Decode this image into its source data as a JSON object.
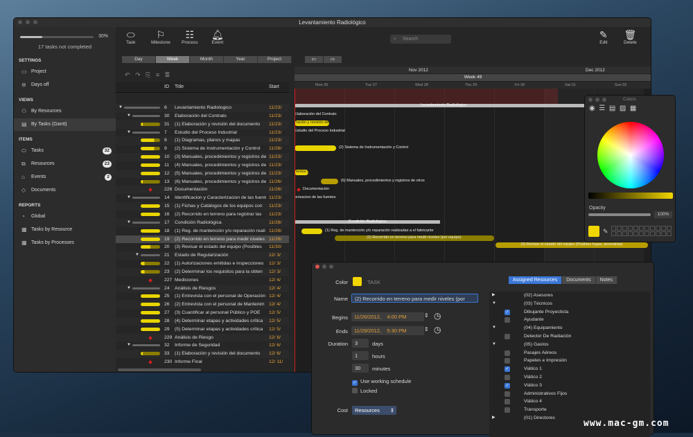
{
  "window": {
    "title": "Levantamiento Radiológico"
  },
  "sidebar": {
    "progress_pct": "30%",
    "progress": 0.3,
    "tasks_not_completed": "17 tasks not completed",
    "sections": [
      {
        "label": "SETTINGS",
        "items": [
          {
            "label": "Project",
            "icon": "project-icon"
          },
          {
            "label": "Days off",
            "icon": "days-off-icon"
          }
        ]
      },
      {
        "label": "VIEWS",
        "items": [
          {
            "label": "By Resources",
            "icon": "resources-icon"
          },
          {
            "label": "By Tasks (Gantt)",
            "icon": "gantt-icon",
            "selected": true
          }
        ]
      },
      {
        "label": "ITEMS",
        "items": [
          {
            "label": "Tasks",
            "count": "32"
          },
          {
            "label": "Resources",
            "count": "23"
          },
          {
            "label": "Events",
            "count": "2"
          },
          {
            "label": "Documents"
          }
        ]
      },
      {
        "label": "REPORTS",
        "items": [
          {
            "label": "Global"
          },
          {
            "label": "Tasks by Resource"
          },
          {
            "label": "Tasks by Processes"
          }
        ]
      }
    ]
  },
  "toolbar": {
    "task": "Task",
    "milestone": "Milestone",
    "process": "Process",
    "event": "Event",
    "search": "Search",
    "edit": "Edit",
    "delete": "Delete"
  },
  "scale": {
    "options": [
      "Day",
      "Week",
      "Month",
      "Year",
      "Project"
    ],
    "selected": "Week"
  },
  "table": {
    "headers": {
      "id": "ID",
      "title": "Title",
      "start": "Start"
    },
    "rows": [
      {
        "id": "6",
        "title": "Levantamiento Radiologico",
        "start": "11/23/",
        "type": "group",
        "indent": 0
      },
      {
        "id": "30",
        "title": "Elaboración del Contrato",
        "start": "11/23/",
        "type": "group",
        "indent": 1
      },
      {
        "id": "31",
        "title": "(1) Elaboración y revisión del documento",
        "start": "11/23/",
        "type": "task",
        "progress": 0.1
      },
      {
        "id": "7",
        "title": "Estudio del Proceso Industrial",
        "start": "11/23/",
        "type": "group",
        "indent": 1
      },
      {
        "id": "8",
        "title": "(1) Diagramas, planos y mapas",
        "start": "11/23/",
        "type": "task",
        "progress": 0.7
      },
      {
        "id": "9",
        "title": "(2) Sistema de Instrumentación y Control",
        "start": "11/26/",
        "type": "task",
        "progress": 0.7
      },
      {
        "id": "10",
        "title": "(3) Manuales, procedimientos y registros de",
        "start": "11/23/",
        "type": "task",
        "progress": 1
      },
      {
        "id": "11",
        "title": "(4) Manuales, procedimientos y registros de",
        "start": "11/23/",
        "type": "task",
        "progress": 1
      },
      {
        "id": "12",
        "title": "(5) Manuales, procedimientos y registros de",
        "start": "11/23/",
        "type": "task",
        "progress": 1
      },
      {
        "id": "13",
        "title": "(6) Manuales, procedimientos y registros de",
        "start": "11/26/",
        "type": "task",
        "progress": 0.1
      },
      {
        "id": "226",
        "title": "Documentación",
        "start": "11/26/",
        "type": "milestone"
      },
      {
        "id": "14",
        "title": "Identificacion y Caracterizacion de las fuentes",
        "start": "11/23/",
        "type": "group",
        "indent": 1
      },
      {
        "id": "15",
        "title": "(1) Fichas y Catálogos de los equipos con",
        "start": "11/23/",
        "type": "task",
        "progress": 1
      },
      {
        "id": "16",
        "title": "(2) Recorrido en terreno para registrar las",
        "start": "11/23/",
        "type": "task",
        "progress": 1
      },
      {
        "id": "17",
        "title": "Condición Radiológica",
        "start": "11/26/",
        "type": "group",
        "indent": 1
      },
      {
        "id": "18",
        "title": "(1) Reg. de mantención y/o reparación reali",
        "start": "11/26/",
        "type": "task",
        "progress": 1
      },
      {
        "id": "19",
        "title": "(2) Recorrido en terreno para medir niveles",
        "start": "11/26/",
        "type": "task",
        "progress": 1,
        "selected": true
      },
      {
        "id": "20",
        "title": "(3) Revisar el estado del equipo (Posibles",
        "start": "11/30/",
        "type": "task",
        "progress": 0.5
      },
      {
        "id": "21",
        "title": "Estado de Regularización",
        "start": "12/ 3/",
        "type": "group",
        "indent": 2
      },
      {
        "id": "22",
        "title": "(1) Autorizaciones emitidas e inspecciones",
        "start": "12/ 3/",
        "type": "task",
        "progress": 0.2
      },
      {
        "id": "23",
        "title": "(2) Determinar los requisitos para la obten",
        "start": "12/ 3/",
        "type": "task",
        "progress": 0.2
      },
      {
        "id": "227",
        "title": "Mediciones",
        "start": "12/ 4/",
        "type": "milestone"
      },
      {
        "id": "24",
        "title": "Análisis de Riesgos",
        "start": "12/ 4/",
        "type": "group",
        "indent": 1
      },
      {
        "id": "25",
        "title": "(1) Entrevista con el personal de Operación",
        "start": "12/ 4/",
        "type": "task",
        "progress": 1
      },
      {
        "id": "26",
        "title": "(2) Entrevista con el personal de Mantenim",
        "start": "12/ 4/",
        "type": "task",
        "progress": 1
      },
      {
        "id": "27",
        "title": "(3) Cuantificar al personal Público y POE",
        "start": "12/ 5/",
        "type": "task",
        "progress": 1
      },
      {
        "id": "28",
        "title": "(4) Determinar etapas y actividades crítica",
        "start": "12/ 5/",
        "type": "task",
        "progress": 1
      },
      {
        "id": "29",
        "title": "(5) Determinar etapas y actividades crítica",
        "start": "12/ 5/",
        "type": "task",
        "progress": 1
      },
      {
        "id": "229",
        "title": "Análisis de Riesgo",
        "start": "12/ 6/",
        "type": "milestone"
      },
      {
        "id": "32",
        "title": "Informe de Seguridad",
        "start": "12/ 6/",
        "type": "group",
        "indent": 1
      },
      {
        "id": "33",
        "title": "(1) Elaboración y revisión del documento",
        "start": "12/ 6/",
        "type": "task",
        "progress": 0.1
      },
      {
        "id": "230",
        "title": "Informe Final",
        "start": "12/ 11/",
        "type": "milestone"
      }
    ]
  },
  "gantt": {
    "months": [
      "Nov 2012",
      "Dec 2012"
    ],
    "week": "Week 49",
    "days": [
      "Mon 26",
      "Tue 27",
      "Wed 28",
      "Thu 29",
      "Fri 30",
      "Sat 01",
      "Sun 02"
    ],
    "bars": [
      {
        "label": "Levantamiento Radiológico"
      },
      {
        "label": "Elaboración del Contrato"
      },
      {
        "label": "ración y revisión del"
      },
      {
        "label": "Estudio del Proceso Industrial"
      },
      {
        "label": "(2) Sistema de Instrumentación y Control"
      },
      {
        "label": "ientos y"
      },
      {
        "label": "(6) Manuales, procedimientos y registros de otros"
      },
      {
        "label": "Documentación"
      },
      {
        "label": "terizacion de las fuentes"
      },
      {
        "label": "Condición Radiológica"
      },
      {
        "label": "(1) Reg. de mantención y/o reparación realizadas a el fabricante"
      },
      {
        "label": "(2) Recorrido en terreno para medir niveles (por equipo)."
      },
      {
        "label": "(3) Revisar el estado del equipo (Posibles fugas, anomalías)"
      }
    ]
  },
  "colors_panel": {
    "title": "Colors",
    "opacity_label": "Opacity",
    "opacity": "100%",
    "selected_color": "#f2d600"
  },
  "inspector": {
    "color_label": "Color",
    "color_name": "TASK",
    "color": "#f2d600",
    "name_label": "Name",
    "name": "(2) Recorrido en terreno para medir niveles (por",
    "begins_label": "Begins",
    "begins_date": "11/26/2012,",
    "begins_time": "4:00 PM",
    "ends_label": "Ends",
    "ends_date": "11/29/2012,",
    "ends_time": "5:30 PM",
    "duration_label": "Duration",
    "days": "3",
    "days_unit": "days",
    "hours": "1",
    "hours_unit": "hours",
    "minutes": "30",
    "minutes_unit": "minutes",
    "working_schedule": "Use working schedule",
    "locked": "Locked",
    "cost_label": "Cost",
    "cost_value": "Resources",
    "tabs": [
      "Assigned Resources",
      "Documents",
      "Notes"
    ],
    "resources": [
      {
        "label": "(02) Asesores",
        "kind": "group"
      },
      {
        "label": "(03) Técnicos",
        "kind": "group"
      },
      {
        "label": "Dibujante Proyectista",
        "checked": true
      },
      {
        "label": "Ayudante",
        "checked": false
      },
      {
        "label": "(04) Equipamiento",
        "kind": "group"
      },
      {
        "label": "Detector De Radiación",
        "checked": false
      },
      {
        "label": "(05) Gastos",
        "kind": "group"
      },
      {
        "label": "Pasajes Aéreos",
        "checked": false
      },
      {
        "label": "Papeles e Impresión",
        "checked": false
      },
      {
        "label": "Viático 1",
        "checked": true
      },
      {
        "label": "Viático 2",
        "checked": false
      },
      {
        "label": "Viático 3",
        "checked": true
      },
      {
        "label": "Administrativos Fijos",
        "checked": false
      },
      {
        "label": "Viático 4",
        "checked": false
      },
      {
        "label": "Transporte",
        "checked": false
      },
      {
        "label": "(01) Directores",
        "kind": "group"
      }
    ]
  },
  "watermark": "www.mac-gm.com"
}
